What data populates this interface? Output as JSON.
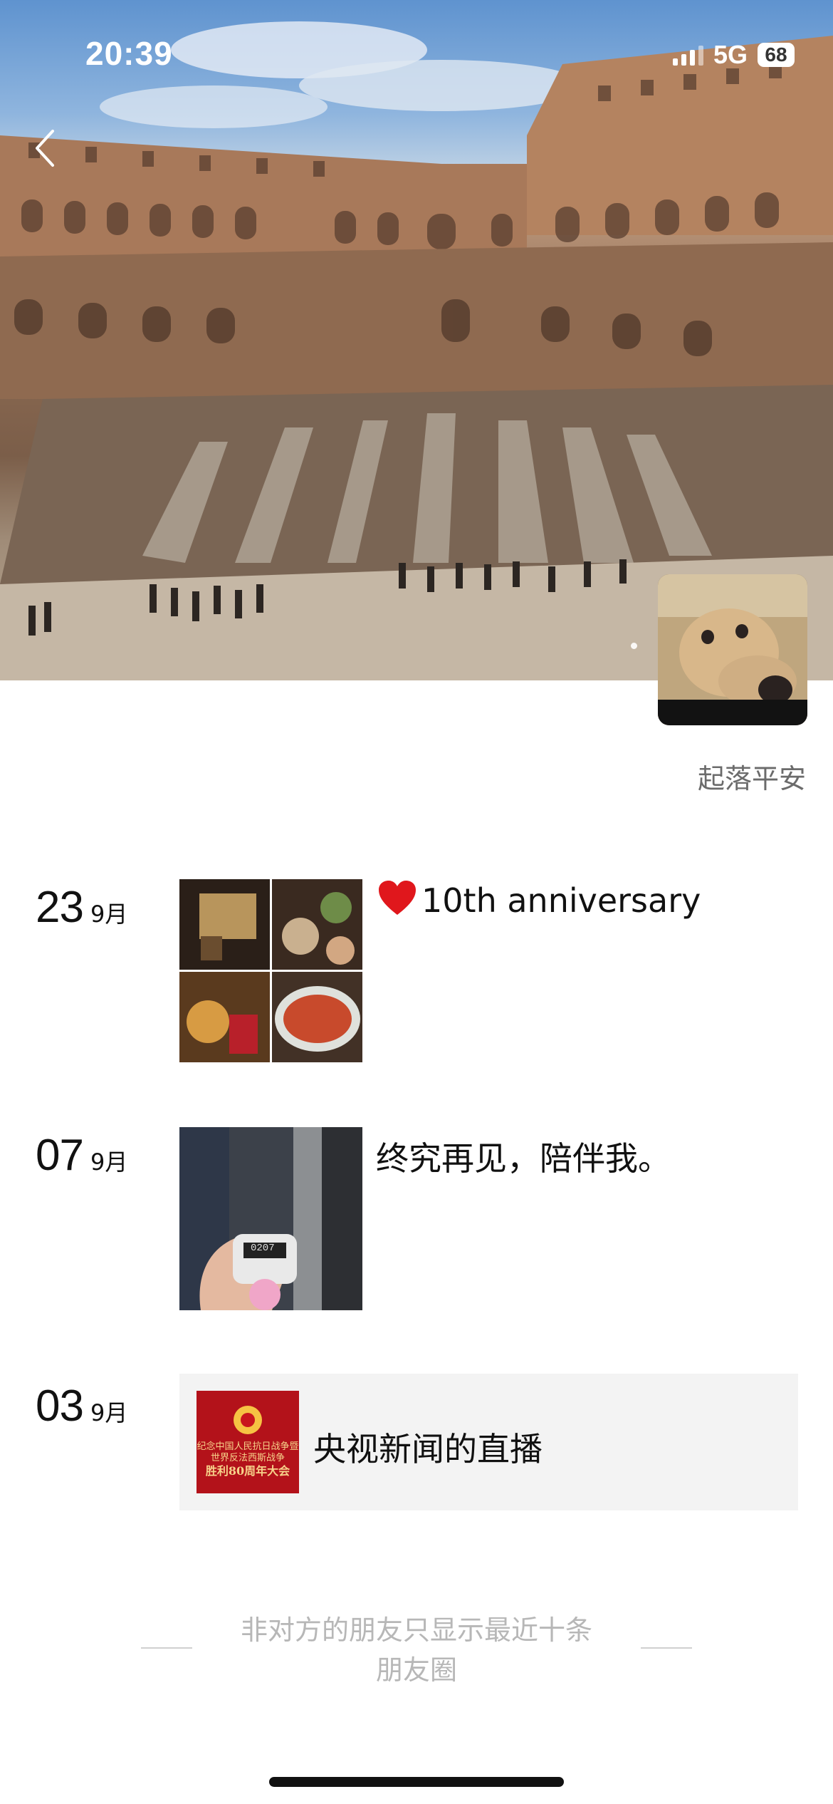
{
  "status_bar": {
    "time": "20:39",
    "network": "5G",
    "battery": "68"
  },
  "profile": {
    "nickname": "起落平安"
  },
  "posts": [
    {
      "day": "23",
      "month": "9月",
      "text": "10th anniversary",
      "icon": "heart-emoji",
      "image_count": 4
    },
    {
      "day": "07",
      "month": "9月",
      "text": "终究再见，陪伴我。",
      "image_count": 1,
      "counter_display": "0207"
    },
    {
      "day": "03",
      "month": "9月",
      "share": {
        "title": "央视新闻的直播",
        "thumb_text_1": "纪念中国人民抗日战争暨世界反法西斯战争",
        "thumb_text_2": "胜利80周年大会"
      }
    }
  ],
  "footer": {
    "line1": "非对方的朋友只显示最近十条",
    "line2": "朋友圈"
  },
  "colors": {
    "share_card_bg": "#f3f3f3",
    "footer_text": "#b7b7b7",
    "nickname": "#6b6b6b"
  }
}
